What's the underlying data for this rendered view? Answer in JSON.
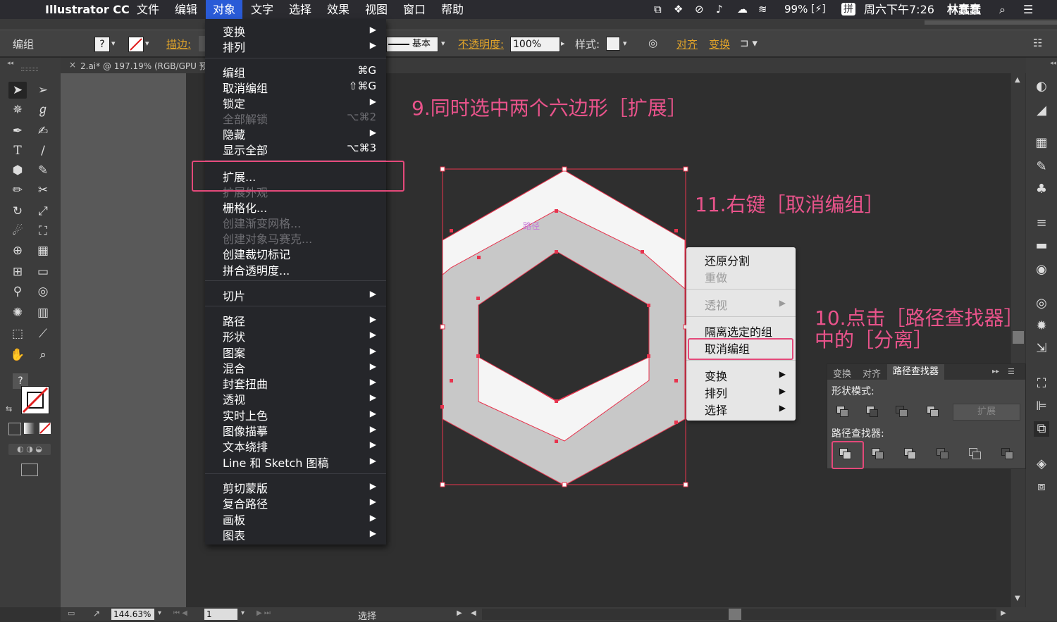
{
  "menubar": {
    "app_name": "Illustrator CC",
    "items": [
      "文件",
      "编辑",
      "对象",
      "文字",
      "选择",
      "效果",
      "视图",
      "窗口",
      "帮助"
    ],
    "battery": "99%",
    "clock": "周六下午7:26",
    "user": "林蠢蠢",
    "input_method": "拼"
  },
  "controlbar": {
    "selection_type": "编组",
    "stroke_label": "描边:",
    "stroke_style": "基本",
    "opacity_label": "不透明度:",
    "opacity_value": "100%",
    "style_label": "样式:",
    "align_label": "对齐",
    "transform_label": "变换"
  },
  "document_tab": {
    "title": "2.ai* @ 197.19% (RGB/GPU 预"
  },
  "object_menu": {
    "items": [
      {
        "label": "变换",
        "arrow": true
      },
      {
        "label": "排列",
        "arrow": true
      },
      {
        "label": "编组",
        "shortcut": "⌘G"
      },
      {
        "label": "取消编组",
        "shortcut": "⇧⌘G"
      },
      {
        "label": "锁定",
        "arrow": true
      },
      {
        "label": "全部解锁",
        "shortcut": "⌥⌘2",
        "disabled": true
      },
      {
        "label": "隐藏",
        "arrow": true
      },
      {
        "label": "显示全部",
        "shortcut": "⌥⌘3"
      },
      {
        "label": "扩展...",
        "highlighted": true
      },
      {
        "label": "扩展外观",
        "disabled": true
      },
      {
        "label": "栅格化..."
      },
      {
        "label": "创建渐变网格...",
        "disabled": true
      },
      {
        "label": "创建对象马赛克...",
        "disabled": true
      },
      {
        "label": "创建裁切标记"
      },
      {
        "label": "拼合透明度..."
      },
      {
        "label": "切片",
        "arrow": true
      },
      {
        "label": "路径",
        "arrow": true
      },
      {
        "label": "形状",
        "arrow": true
      },
      {
        "label": "图案",
        "arrow": true
      },
      {
        "label": "混合",
        "arrow": true
      },
      {
        "label": "封套扭曲",
        "arrow": true
      },
      {
        "label": "透视",
        "arrow": true
      },
      {
        "label": "实时上色",
        "arrow": true
      },
      {
        "label": "图像描摹",
        "arrow": true
      },
      {
        "label": "文本绕排",
        "arrow": true
      },
      {
        "label": "Line 和 Sketch 图稿",
        "arrow": true
      },
      {
        "label": "剪切蒙版",
        "arrow": true
      },
      {
        "label": "复合路径",
        "arrow": true
      },
      {
        "label": "画板",
        "arrow": true
      },
      {
        "label": "图表",
        "arrow": true
      }
    ]
  },
  "context_menu": {
    "items": [
      {
        "label": "还原分割"
      },
      {
        "label": "重做",
        "disabled": true
      },
      {
        "label": "透视",
        "arrow": true,
        "disabled": true
      },
      {
        "label": "隔离选定的组"
      },
      {
        "label": "取消编组"
      },
      {
        "label": "变换",
        "arrow": true
      },
      {
        "label": "排列",
        "arrow": true
      },
      {
        "label": "选择",
        "arrow": true
      }
    ]
  },
  "pathfinder_panel": {
    "tabs": [
      "变换",
      "对齐",
      "路径查找器"
    ],
    "shape_modes_label": "形状模式:",
    "expand_button": "扩展",
    "pathfinders_label": "路径查找器:"
  },
  "canvas": {
    "path_hint": "路径"
  },
  "annotations": {
    "step9": "9.同时选中两个六边形［扩展］",
    "step11": "11.右键［取消编组］",
    "step10_line1": "10.点击［路径查找器］",
    "step10_line2": "中的［分离］"
  },
  "statusbar": {
    "zoom": "144.63%",
    "page": "1",
    "mode": "选择"
  },
  "colors": {
    "accent_pink": "#e9538b",
    "menu_highlight": "#2a5bd7",
    "hex_fill_light": "#f5f5f5",
    "hex_fill_gray": "#c8c8c8",
    "selection": "#e8344e"
  },
  "icons": [
    "apple-icon",
    "wifi-icon",
    "search-icon",
    "list-icon",
    "selection-tool-icon",
    "direct-selection-icon",
    "pen-tool-icon",
    "type-tool-icon",
    "hand-tool-icon",
    "zoom-tool-icon",
    "libraries-icon",
    "layers-icon"
  ]
}
